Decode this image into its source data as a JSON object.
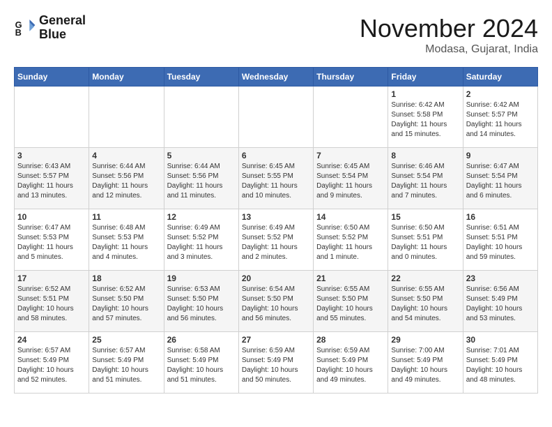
{
  "logo": {
    "line1": "General",
    "line2": "Blue"
  },
  "title": "November 2024",
  "location": "Modasa, Gujarat, India",
  "weekdays": [
    "Sunday",
    "Monday",
    "Tuesday",
    "Wednesday",
    "Thursday",
    "Friday",
    "Saturday"
  ],
  "weeks": [
    [
      {
        "day": "",
        "info": ""
      },
      {
        "day": "",
        "info": ""
      },
      {
        "day": "",
        "info": ""
      },
      {
        "day": "",
        "info": ""
      },
      {
        "day": "",
        "info": ""
      },
      {
        "day": "1",
        "info": "Sunrise: 6:42 AM\nSunset: 5:58 PM\nDaylight: 11 hours\nand 15 minutes."
      },
      {
        "day": "2",
        "info": "Sunrise: 6:42 AM\nSunset: 5:57 PM\nDaylight: 11 hours\nand 14 minutes."
      }
    ],
    [
      {
        "day": "3",
        "info": "Sunrise: 6:43 AM\nSunset: 5:57 PM\nDaylight: 11 hours\nand 13 minutes."
      },
      {
        "day": "4",
        "info": "Sunrise: 6:44 AM\nSunset: 5:56 PM\nDaylight: 11 hours\nand 12 minutes."
      },
      {
        "day": "5",
        "info": "Sunrise: 6:44 AM\nSunset: 5:56 PM\nDaylight: 11 hours\nand 11 minutes."
      },
      {
        "day": "6",
        "info": "Sunrise: 6:45 AM\nSunset: 5:55 PM\nDaylight: 11 hours\nand 10 minutes."
      },
      {
        "day": "7",
        "info": "Sunrise: 6:45 AM\nSunset: 5:54 PM\nDaylight: 11 hours\nand 9 minutes."
      },
      {
        "day": "8",
        "info": "Sunrise: 6:46 AM\nSunset: 5:54 PM\nDaylight: 11 hours\nand 7 minutes."
      },
      {
        "day": "9",
        "info": "Sunrise: 6:47 AM\nSunset: 5:54 PM\nDaylight: 11 hours\nand 6 minutes."
      }
    ],
    [
      {
        "day": "10",
        "info": "Sunrise: 6:47 AM\nSunset: 5:53 PM\nDaylight: 11 hours\nand 5 minutes."
      },
      {
        "day": "11",
        "info": "Sunrise: 6:48 AM\nSunset: 5:53 PM\nDaylight: 11 hours\nand 4 minutes."
      },
      {
        "day": "12",
        "info": "Sunrise: 6:49 AM\nSunset: 5:52 PM\nDaylight: 11 hours\nand 3 minutes."
      },
      {
        "day": "13",
        "info": "Sunrise: 6:49 AM\nSunset: 5:52 PM\nDaylight: 11 hours\nand 2 minutes."
      },
      {
        "day": "14",
        "info": "Sunrise: 6:50 AM\nSunset: 5:52 PM\nDaylight: 11 hours\nand 1 minute."
      },
      {
        "day": "15",
        "info": "Sunrise: 6:50 AM\nSunset: 5:51 PM\nDaylight: 11 hours\nand 0 minutes."
      },
      {
        "day": "16",
        "info": "Sunrise: 6:51 AM\nSunset: 5:51 PM\nDaylight: 10 hours\nand 59 minutes."
      }
    ],
    [
      {
        "day": "17",
        "info": "Sunrise: 6:52 AM\nSunset: 5:51 PM\nDaylight: 10 hours\nand 58 minutes."
      },
      {
        "day": "18",
        "info": "Sunrise: 6:52 AM\nSunset: 5:50 PM\nDaylight: 10 hours\nand 57 minutes."
      },
      {
        "day": "19",
        "info": "Sunrise: 6:53 AM\nSunset: 5:50 PM\nDaylight: 10 hours\nand 56 minutes."
      },
      {
        "day": "20",
        "info": "Sunrise: 6:54 AM\nSunset: 5:50 PM\nDaylight: 10 hours\nand 56 minutes."
      },
      {
        "day": "21",
        "info": "Sunrise: 6:55 AM\nSunset: 5:50 PM\nDaylight: 10 hours\nand 55 minutes."
      },
      {
        "day": "22",
        "info": "Sunrise: 6:55 AM\nSunset: 5:50 PM\nDaylight: 10 hours\nand 54 minutes."
      },
      {
        "day": "23",
        "info": "Sunrise: 6:56 AM\nSunset: 5:49 PM\nDaylight: 10 hours\nand 53 minutes."
      }
    ],
    [
      {
        "day": "24",
        "info": "Sunrise: 6:57 AM\nSunset: 5:49 PM\nDaylight: 10 hours\nand 52 minutes."
      },
      {
        "day": "25",
        "info": "Sunrise: 6:57 AM\nSunset: 5:49 PM\nDaylight: 10 hours\nand 51 minutes."
      },
      {
        "day": "26",
        "info": "Sunrise: 6:58 AM\nSunset: 5:49 PM\nDaylight: 10 hours\nand 51 minutes."
      },
      {
        "day": "27",
        "info": "Sunrise: 6:59 AM\nSunset: 5:49 PM\nDaylight: 10 hours\nand 50 minutes."
      },
      {
        "day": "28",
        "info": "Sunrise: 6:59 AM\nSunset: 5:49 PM\nDaylight: 10 hours\nand 49 minutes."
      },
      {
        "day": "29",
        "info": "Sunrise: 7:00 AM\nSunset: 5:49 PM\nDaylight: 10 hours\nand 49 minutes."
      },
      {
        "day": "30",
        "info": "Sunrise: 7:01 AM\nSunset: 5:49 PM\nDaylight: 10 hours\nand 48 minutes."
      }
    ]
  ]
}
